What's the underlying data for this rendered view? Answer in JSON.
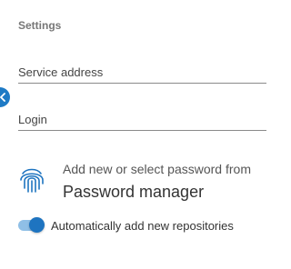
{
  "settings": {
    "title": "Settings"
  },
  "form": {
    "service_address": {
      "placeholder": "Service address",
      "value": ""
    },
    "login": {
      "placeholder": "Login",
      "value": ""
    }
  },
  "password_manager": {
    "icon": "fingerprint-icon",
    "line1": "Add new or select password from",
    "line2": "Password manager"
  },
  "expand_handle": {
    "icon": "chevron-left-icon"
  },
  "auto_add": {
    "label": "Automatically add new repositories",
    "enabled": true
  },
  "colors": {
    "accent": "#1e74c0",
    "toggle_track": "#8fbfe6"
  }
}
